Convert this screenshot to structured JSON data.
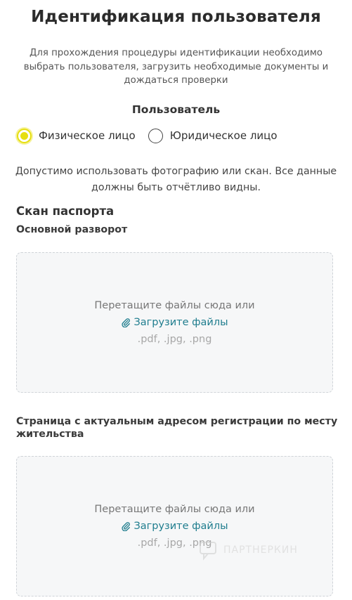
{
  "page": {
    "title": "Идентификация пользователя",
    "intro": "Для прохождения процедуры идентификации необходимо выбрать пользователя, загрузить необходимые документы и дождаться проверки"
  },
  "user_type": {
    "heading": "Пользователь",
    "options": [
      {
        "label": "Физическое лицо",
        "selected": true
      },
      {
        "label": "Юридическое лицо",
        "selected": false
      }
    ],
    "accent_color": "#e6df0f"
  },
  "notice": "Допустимо использовать фотографию или скан. Все данные должны быть отчётливо видны.",
  "passport": {
    "heading": "Скан паспорта",
    "uploads": [
      {
        "label": "Основной разворот",
        "drop_text": "Перетащите файлы сюда или",
        "upload_link": "Загрузите файлы",
        "formats": ".pdf, .jpg, .png"
      },
      {
        "label": "Страница с актуальным адресом регистрации по месту жительства",
        "drop_text": "Перетащите файлы сюда или",
        "upload_link": "Загрузите файлы",
        "formats": ".pdf, .jpg, .png"
      }
    ]
  },
  "watermark": {
    "text": "ПАРТНЕРКИН",
    "icon": "chat-bubble-icon"
  },
  "colors": {
    "link": "#1f7d8e",
    "dropzone_bg": "#f6f7f8"
  }
}
